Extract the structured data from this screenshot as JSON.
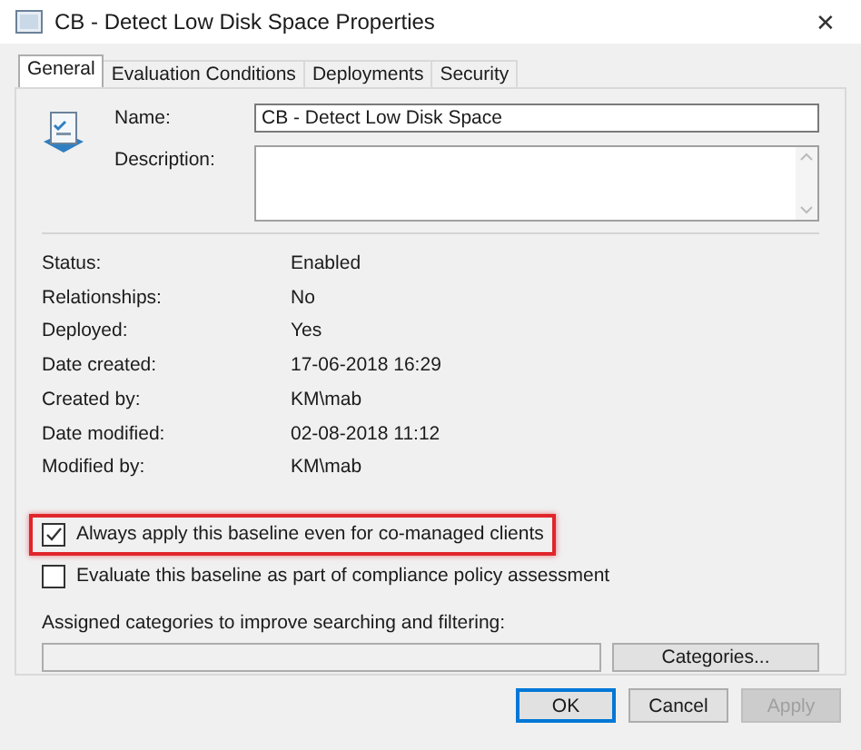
{
  "window": {
    "title": "CB - Detect Low Disk Space Properties",
    "close": "✕"
  },
  "tabs": [
    {
      "label": "General",
      "selected": true
    },
    {
      "label": "Evaluation Conditions",
      "selected": false
    },
    {
      "label": "Deployments",
      "selected": false
    },
    {
      "label": "Security",
      "selected": false
    }
  ],
  "name_field": {
    "label": "Name:",
    "value": "CB - Detect Low Disk Space"
  },
  "description_field": {
    "label": "Description:"
  },
  "properties": [
    {
      "label": "Status:",
      "value": "Enabled"
    },
    {
      "label": "Relationships:",
      "value": "No"
    },
    {
      "label": "Deployed:",
      "value": "Yes"
    },
    {
      "label": "Date created:",
      "value": "17-06-2018 16:29"
    },
    {
      "label": "Created by:",
      "value": "KM\\mab"
    },
    {
      "label": "Date modified:",
      "value": "02-08-2018 11:12"
    },
    {
      "label": "Modified by:",
      "value": "KM\\mab"
    }
  ],
  "checkboxes": [
    {
      "label": "Always apply this baseline even for co-managed clients",
      "checked": true,
      "highlighted": true
    },
    {
      "label": "Evaluate this baseline as part of compliance policy assessment",
      "checked": false,
      "highlighted": false
    }
  ],
  "categories": {
    "label": "Assigned categories to improve searching and filtering:",
    "button": "Categories..."
  },
  "buttons": [
    {
      "label": "OK",
      "default": true,
      "disabled": false
    },
    {
      "label": "Cancel",
      "default": false,
      "disabled": false
    },
    {
      "label": "Apply",
      "default": false,
      "disabled": true
    }
  ]
}
